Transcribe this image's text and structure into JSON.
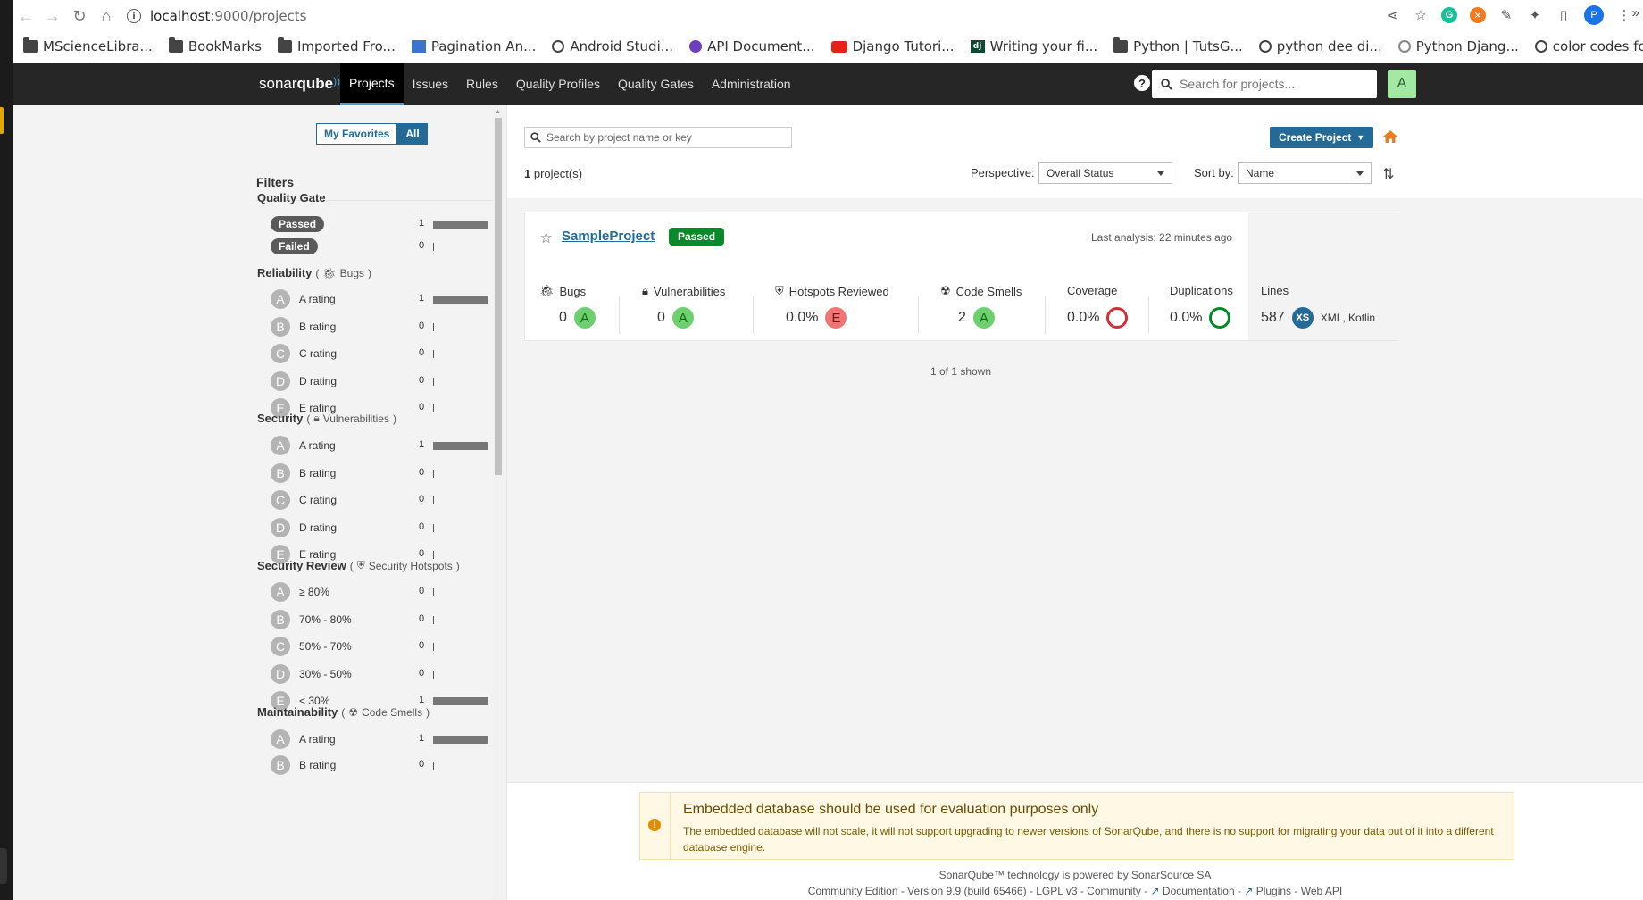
{
  "browser": {
    "url_host": "localhost",
    "url_path": ":9000/projects",
    "bookmarks": [
      {
        "label": "MScienceLibra...",
        "icon": "folder"
      },
      {
        "label": "BookMarks",
        "icon": "folder"
      },
      {
        "label": "Imported Fro...",
        "icon": "folder"
      },
      {
        "label": "Pagination An...",
        "icon": "pag"
      },
      {
        "label": "Android Studi...",
        "icon": "globe"
      },
      {
        "label": "API Document...",
        "icon": "api"
      },
      {
        "label": "Django Tutori...",
        "icon": "yt"
      },
      {
        "label": "Writing your fi...",
        "icon": "dj"
      },
      {
        "label": "Python | TutsG...",
        "icon": "folder"
      },
      {
        "label": "python dee di...",
        "icon": "globe"
      },
      {
        "label": "Python Djang...",
        "icon": "py"
      },
      {
        "label": "color codes fo...",
        "icon": "globe"
      }
    ]
  },
  "nav": {
    "logo_a": "sonar",
    "logo_b": "qube",
    "tabs": [
      "Projects",
      "Issues",
      "Rules",
      "Quality Profiles",
      "Quality Gates",
      "Administration"
    ],
    "search_placeholder": "Search for projects...",
    "avatar": "A"
  },
  "sidebar": {
    "my_favorites": "My Favorites",
    "all": "All",
    "filters_title": "Filters",
    "quality_gate": {
      "title": "Quality Gate",
      "rows": [
        {
          "label": "Passed",
          "count": "1",
          "fraction": 1
        },
        {
          "label": "Failed",
          "count": "0",
          "fraction": 0
        }
      ]
    },
    "reliability": {
      "title": "Reliability",
      "sub": "Bugs",
      "rows": [
        {
          "letter": "A",
          "label": "A rating",
          "count": "1",
          "fraction": 1
        },
        {
          "letter": "B",
          "label": "B rating",
          "count": "0",
          "fraction": 0
        },
        {
          "letter": "C",
          "label": "C rating",
          "count": "0",
          "fraction": 0
        },
        {
          "letter": "D",
          "label": "D rating",
          "count": "0",
          "fraction": 0
        },
        {
          "letter": "E",
          "label": "E rating",
          "count": "0",
          "fraction": 0
        }
      ]
    },
    "security": {
      "title": "Security",
      "sub": "Vulnerabilities",
      "rows": [
        {
          "letter": "A",
          "label": "A rating",
          "count": "1",
          "fraction": 1
        },
        {
          "letter": "B",
          "label": "B rating",
          "count": "0",
          "fraction": 0
        },
        {
          "letter": "C",
          "label": "C rating",
          "count": "0",
          "fraction": 0
        },
        {
          "letter": "D",
          "label": "D rating",
          "count": "0",
          "fraction": 0
        },
        {
          "letter": "E",
          "label": "E rating",
          "count": "0",
          "fraction": 0
        }
      ]
    },
    "security_review": {
      "title": "Security Review",
      "sub": "Security Hotspots",
      "rows": [
        {
          "letter": "A",
          "label": "≥ 80%",
          "count": "0",
          "fraction": 0
        },
        {
          "letter": "B",
          "label": "70% - 80%",
          "count": "0",
          "fraction": 0
        },
        {
          "letter": "C",
          "label": "50% - 70%",
          "count": "0",
          "fraction": 0
        },
        {
          "letter": "D",
          "label": "30% - 50%",
          "count": "0",
          "fraction": 0
        },
        {
          "letter": "E",
          "label": "< 30%",
          "count": "1",
          "fraction": 1
        }
      ]
    },
    "maintainability": {
      "title": "Maintainability",
      "sub": "Code Smells",
      "rows": [
        {
          "letter": "A",
          "label": "A rating",
          "count": "1",
          "fraction": 1
        },
        {
          "letter": "B",
          "label": "B rating",
          "count": "0",
          "fraction": 0
        }
      ]
    }
  },
  "main": {
    "search_placeholder": "Search by project name or key",
    "create_project": "Create Project",
    "project_count": "1",
    "project_count_suffix": " project(s)",
    "perspective_label": "Perspective:",
    "perspective_value": "Overall Status",
    "sort_label": "Sort by:",
    "sort_value": "Name",
    "shown": "1 of 1 shown"
  },
  "project": {
    "name": "SampleProject",
    "status": "Passed",
    "last_analysis": "Last analysis: 22 minutes ago",
    "metrics": {
      "bugs": {
        "label": "Bugs",
        "value": "0",
        "rating": "A"
      },
      "vulnerabilities": {
        "label": "Vulnerabilities",
        "value": "0",
        "rating": "A"
      },
      "hotspots": {
        "label": "Hotspots Reviewed",
        "value": "0.0%",
        "rating": "E"
      },
      "code_smells": {
        "label": "Code Smells",
        "value": "2",
        "rating": "A"
      },
      "coverage": {
        "label": "Coverage",
        "value": "0.0%"
      },
      "duplications": {
        "label": "Duplications",
        "value": "0.0%"
      },
      "lines": {
        "label": "Lines",
        "value": "587",
        "size": "XS",
        "languages": "XML, Kotlin"
      }
    }
  },
  "footer": {
    "warning_title": "Embedded database should be used for evaluation purposes only",
    "warning_text": "The embedded database will not scale, it will not support upgrading to newer versions of SonarQube, and there is no support for migrating your data out of it into a different database engine.",
    "powered_prefix": "SonarQube™ technology is powered by ",
    "powered_link": "SonarSource SA",
    "edition": "Community Edition - Version 9.9 (build 65466) - ",
    "links": [
      "LGPL v3",
      "Community",
      "Documentation",
      "Plugins",
      "Web API"
    ]
  },
  "colors": {
    "nav_bg": "#262626",
    "accent": "#236a97",
    "passed": "#0a8a2a",
    "rating_a": "#6ecf6e",
    "rating_e": "#f07676"
  }
}
